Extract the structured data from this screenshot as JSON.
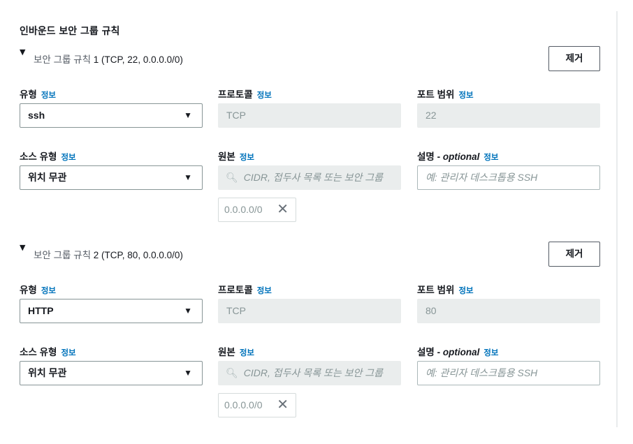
{
  "section": {
    "title": "인바운드 보안 그룹 규칙"
  },
  "info_label": "정보",
  "remove_label": "제거",
  "rules": [
    {
      "title_prefix": "보안 그룹 규칙 ",
      "title_tail": "1 (TCP, 22, 0.0.0.0/0)",
      "type_label": "유형",
      "type_value": "ssh",
      "protocol_label": "프로토콜",
      "protocol_value": "TCP",
      "port_label": "포트 범위",
      "port_value": "22",
      "source_type_label": "소스 유형",
      "source_type_value": "위치 무관",
      "source_label": "원본",
      "source_placeholder": "CIDR, 접두사 목록 또는 보안 그룹",
      "source_chip": "0.0.0.0/0",
      "desc_label": "설명 - ",
      "desc_optional": "optional",
      "desc_placeholder": "예: 관리자 데스크톱용 SSH"
    },
    {
      "title_prefix": "보안 그룹 규칙 ",
      "title_tail": "2 (TCP, 80, 0.0.0.0/0)",
      "type_label": "유형",
      "type_value": "HTTP",
      "protocol_label": "프로토콜",
      "protocol_value": "TCP",
      "port_label": "포트 범위",
      "port_value": "80",
      "source_type_label": "소스 유형",
      "source_type_value": "위치 무관",
      "source_label": "원본",
      "source_placeholder": "CIDR, 접두사 목록 또는 보안 그룹",
      "source_chip": "0.0.0.0/0",
      "desc_label": "설명 - ",
      "desc_optional": "optional",
      "desc_placeholder": "예: 관리자 데스크톱용 SSH"
    }
  ],
  "icons": {
    "caret": "caret-down-icon",
    "select_arrow": "dropdown-arrow-icon",
    "search": "search-icon",
    "remove_chip": "close-icon"
  },
  "colors": {
    "info_link": "#0073bb",
    "disabled_bg": "#eaeded",
    "border": "#879596"
  }
}
